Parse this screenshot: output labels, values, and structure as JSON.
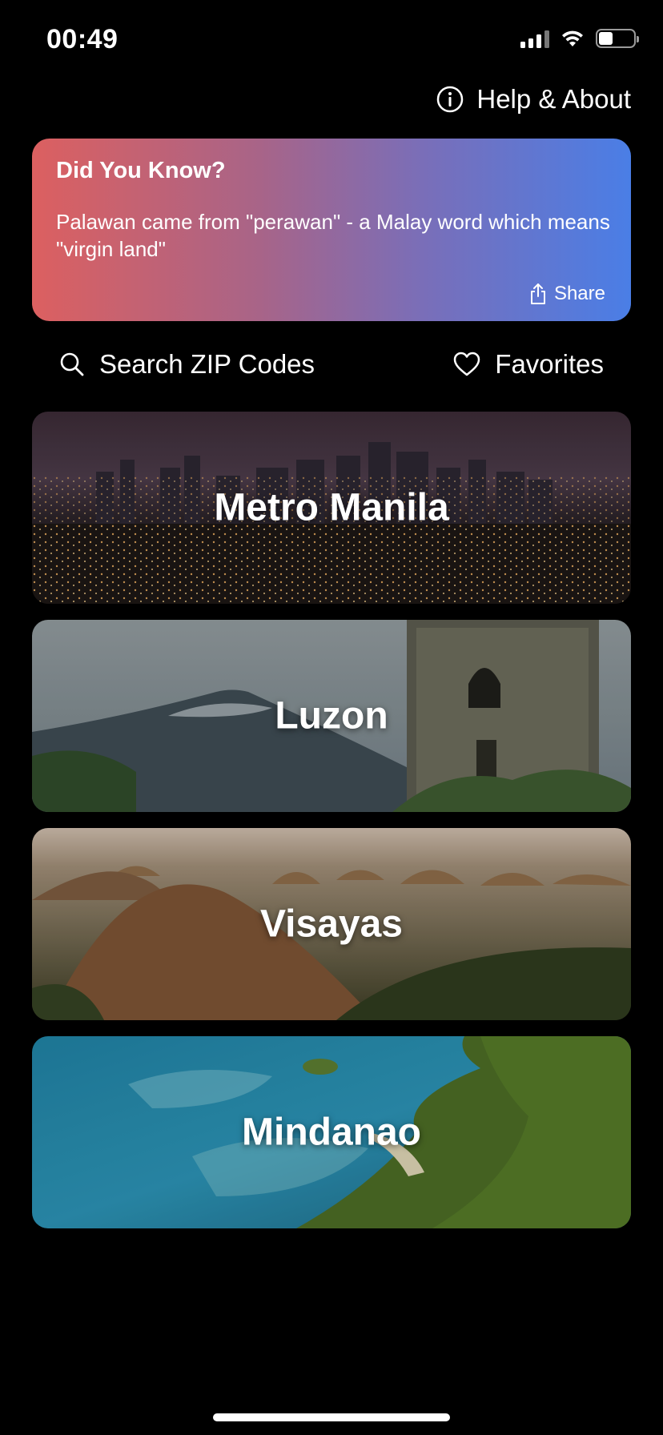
{
  "status_bar": {
    "time": "00:49"
  },
  "header": {
    "help_label": "Help & About"
  },
  "did_you_know": {
    "title": "Did You Know?",
    "text": "Palawan came from \"perawan\" - a Malay word which means \"virgin land\"",
    "share_label": "Share",
    "gradient_start": "#dc6060",
    "gradient_end": "#4a7ee6"
  },
  "actions": {
    "search_label": "Search ZIP Codes",
    "favorites_label": "Favorites"
  },
  "regions": [
    {
      "name": "Metro Manila",
      "image": "night-city-skyline"
    },
    {
      "name": "Luzon",
      "image": "volcano-and-bell-tower"
    },
    {
      "name": "Visayas",
      "image": "chocolate-hills"
    },
    {
      "name": "Mindanao",
      "image": "coastline-reef-aerial"
    }
  ],
  "colors": {
    "background": "#000000",
    "text": "#ffffff"
  }
}
